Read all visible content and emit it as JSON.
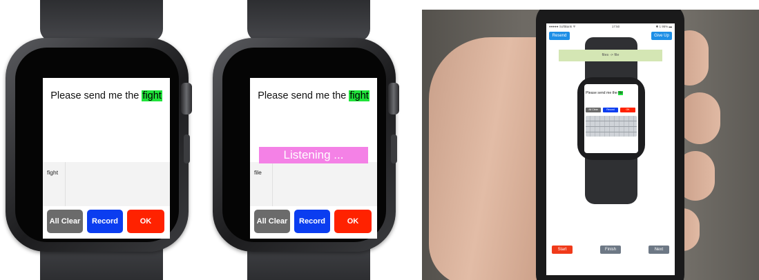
{
  "watch_left": {
    "prompt_text": "Please send me the ",
    "highlight_word": "fight",
    "input_text": "fight",
    "buttons": {
      "clear": "All Clear",
      "record": "Record",
      "ok": "OK"
    }
  },
  "watch_right": {
    "prompt_text": "Please send me the ",
    "highlight_word": "fight",
    "listening_text": "Listening ...",
    "input_text": "file",
    "buttons": {
      "clear": "All Clear",
      "record": "Record",
      "ok": "OK"
    }
  },
  "phone": {
    "status_left": "●●●●● SoftBank ᯤ",
    "status_center": "17:50",
    "status_right": "✱ 1 95% ▬",
    "resend_label": "Resend",
    "give_up_label": "Give Up",
    "feedback_text": "files -> file",
    "watch_prompt": "Please send me the ",
    "watch_highlight": "file",
    "watch_buttons": {
      "clear": "All Clear",
      "record": "Record",
      "ok": "OK"
    },
    "start_label": "Start",
    "finish_label": "Finish",
    "next_label": "Next"
  },
  "colors": {
    "highlight": "#1fe33a",
    "clear_btn": "#6b6b6b",
    "record_btn": "#0b3df0",
    "ok_btn": "#ff2200",
    "listening": "#f481e6",
    "phone_blue": "#1e8fe6",
    "start_red": "#f03a1a",
    "gray_btn": "#6d7885"
  }
}
